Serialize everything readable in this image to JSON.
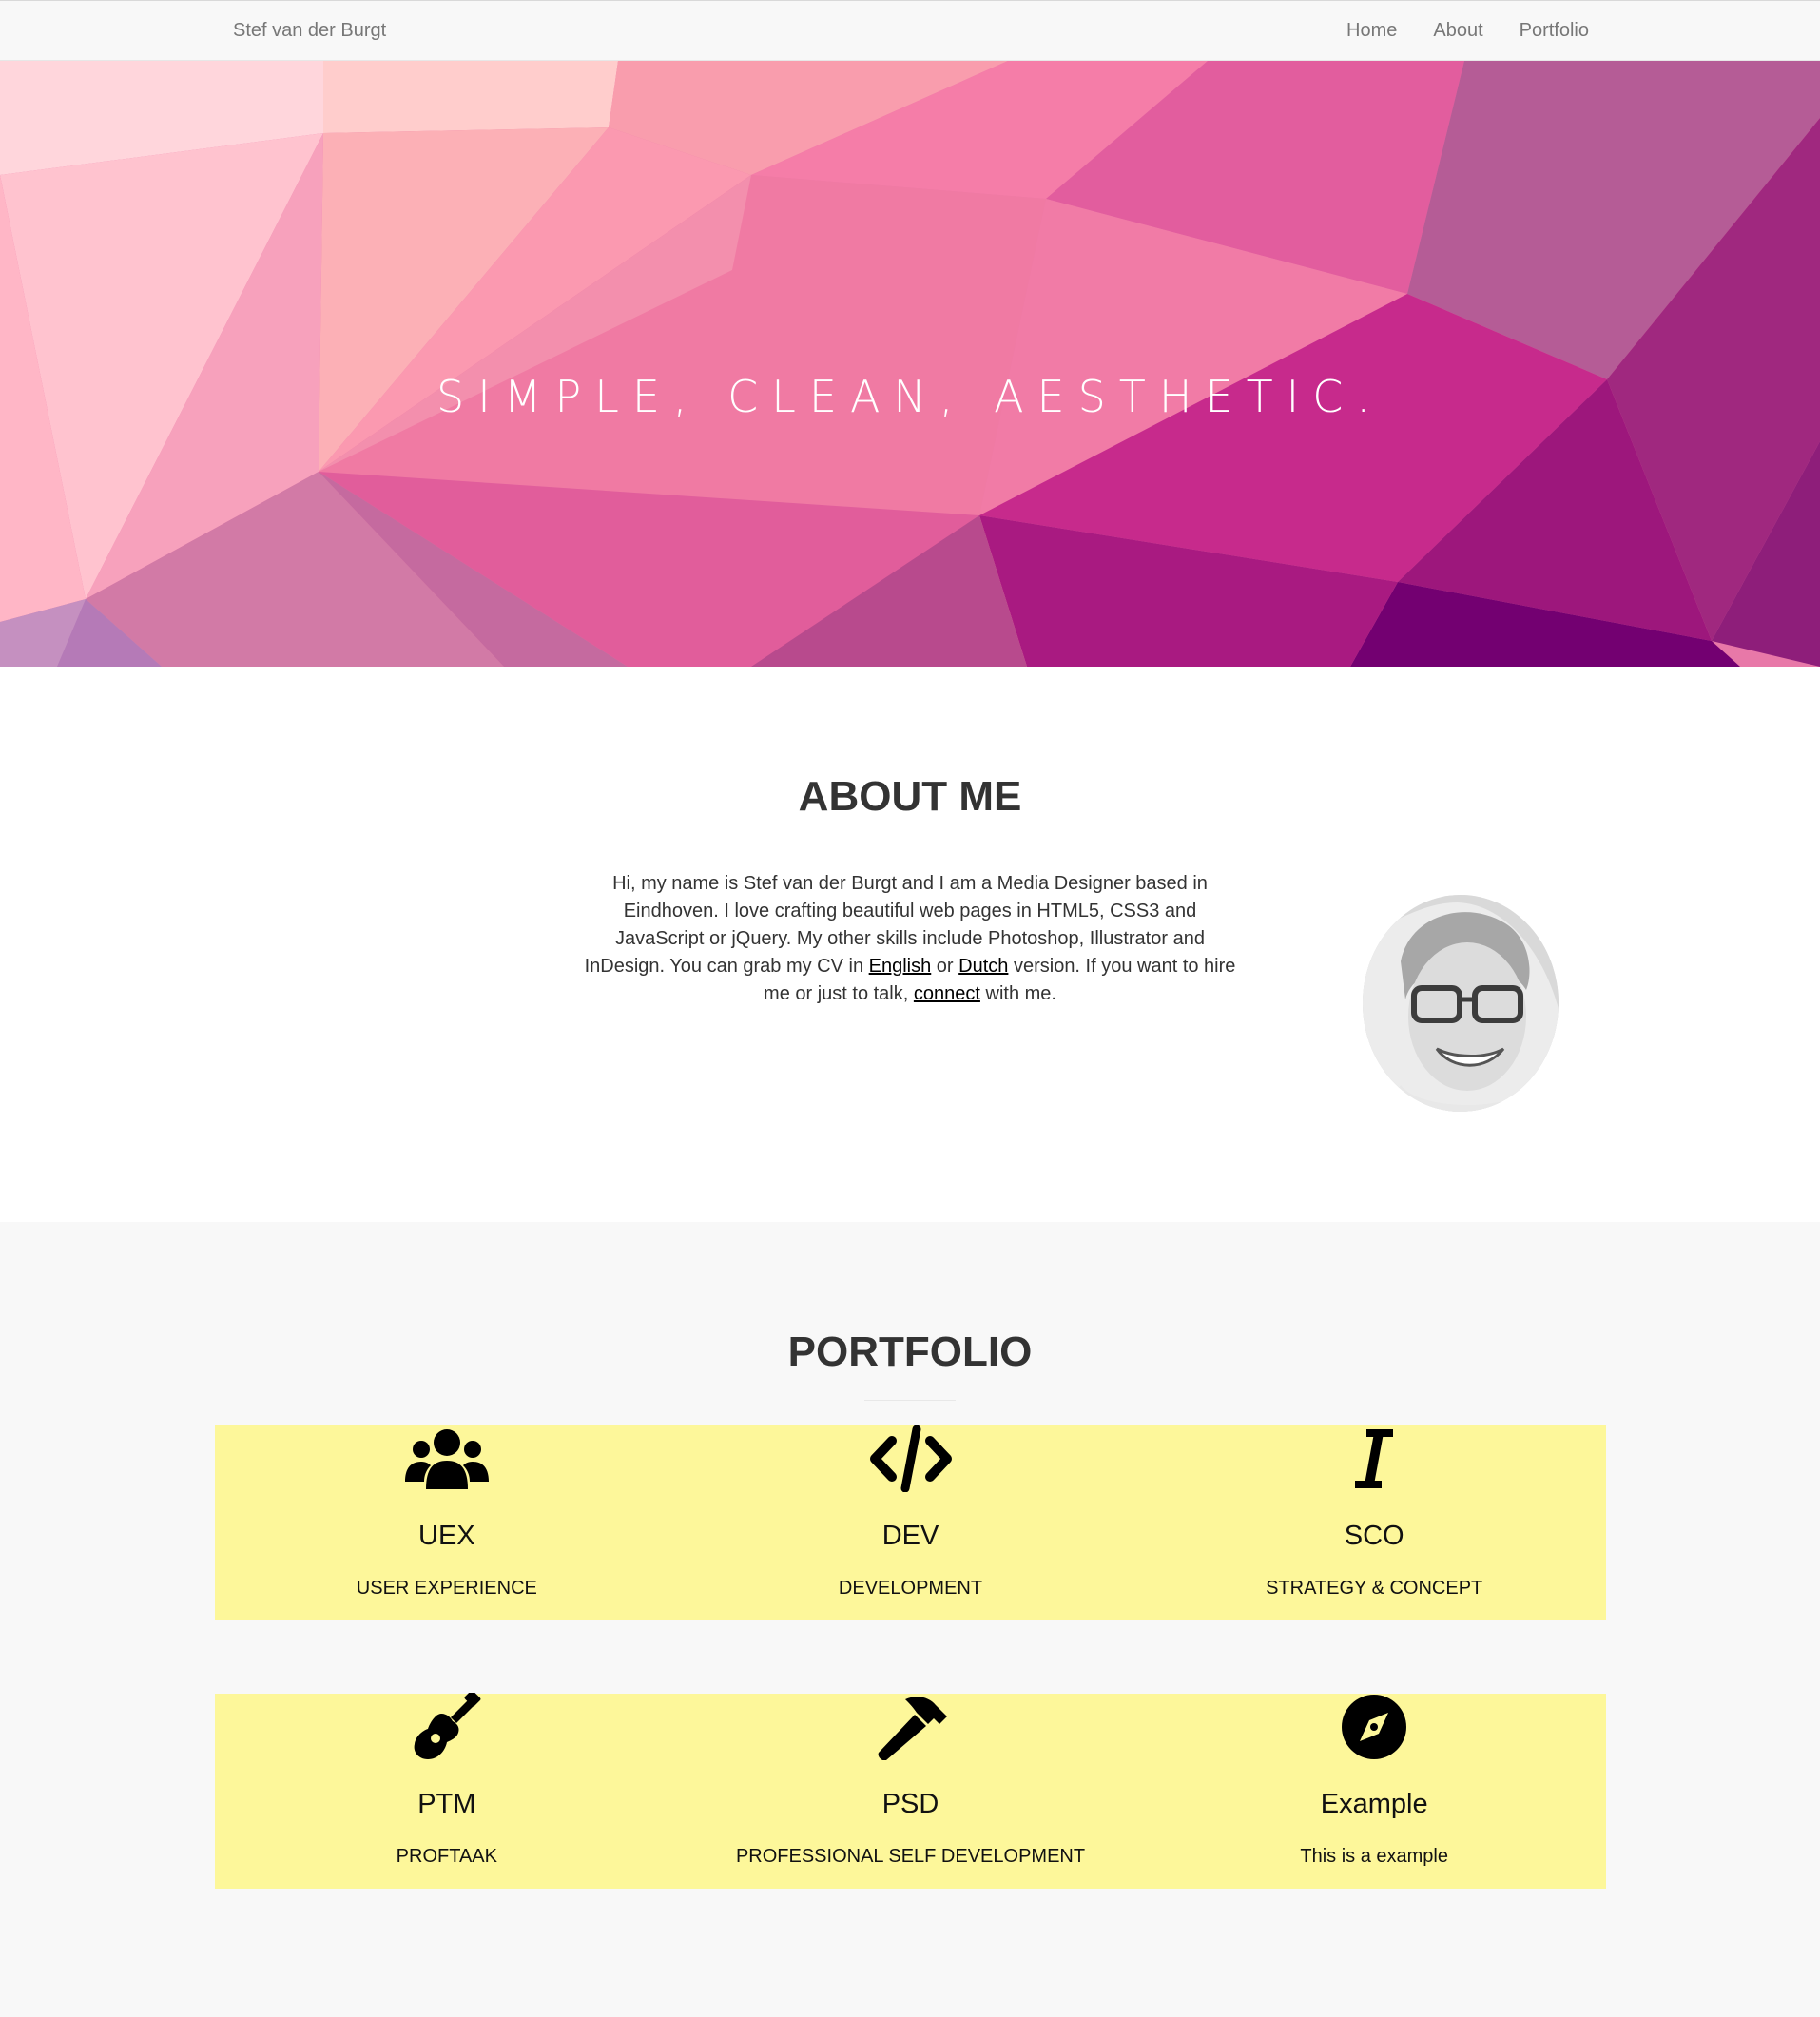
{
  "navbar": {
    "brand": "Stef van der Burgt",
    "links": [
      {
        "label": "Home"
      },
      {
        "label": "About"
      },
      {
        "label": "Portfolio"
      }
    ]
  },
  "hero": {
    "headline": "SIMPLE, CLEAN, AESTHETIC."
  },
  "about": {
    "title": "ABOUT ME",
    "text_intro": "Hi, my name is Stef van der Burgt and I am a Media Designer based in Eindhoven. I love crafting beautiful web pages in HTML5, CSS3 and JavaScript or jQuery. My other skills include Photoshop, Illustrator and InDesign. You can grab my CV in ",
    "link_english": "English",
    "text_or": " or ",
    "link_dutch": "Dutch",
    "text_mid": " version. If you want to hire me or just to talk, ",
    "link_connect": "connect",
    "text_end": " with me."
  },
  "portfolio": {
    "title": "PORTFOLIO",
    "items": [
      {
        "icon": "users-icon",
        "title": "UEX",
        "subtitle": "USER EXPERIENCE"
      },
      {
        "icon": "code-icon",
        "title": "DEV",
        "subtitle": "DEVELOPMENT"
      },
      {
        "icon": "italic-icon",
        "title": "SCO",
        "subtitle": "STRATEGY & CONCEPT"
      },
      {
        "icon": "guitar-icon",
        "title": "PTM",
        "subtitle": "PROFTAAK"
      },
      {
        "icon": "hammer-icon",
        "title": "PSD",
        "subtitle": "PROFESSIONAL SELF DEVELOPMENT"
      },
      {
        "icon": "compass-icon",
        "title": "Example",
        "subtitle": "This is a example"
      }
    ]
  },
  "colors": {
    "card_background": "#fdf79a",
    "nav_text": "#777777",
    "hero_pink": "#f06fa0",
    "hero_purple": "#9b1a7e"
  }
}
